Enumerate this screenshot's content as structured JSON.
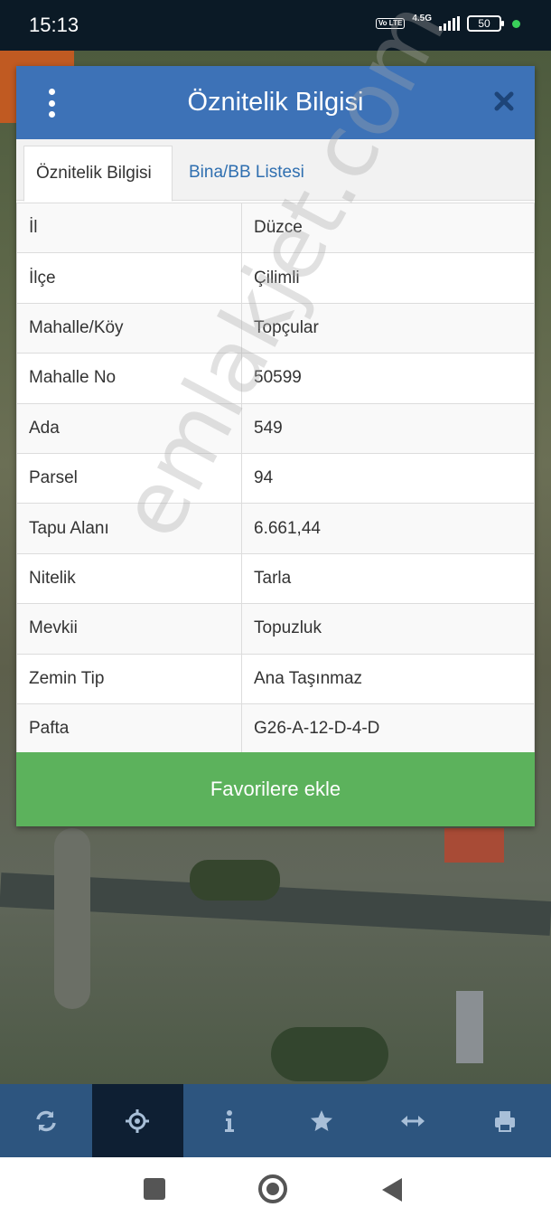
{
  "status_bar": {
    "time": "15:13",
    "network_badge": "Vo LTE",
    "network_type": "4.5G",
    "battery": "50"
  },
  "dialog": {
    "title": "Öznitelik Bilgisi",
    "tabs": [
      {
        "label": "Öznitelik Bilgisi",
        "active": true
      },
      {
        "label": "Bina/BB Listesi",
        "active": false
      }
    ],
    "rows": [
      {
        "key": "İl",
        "value": "Düzce"
      },
      {
        "key": "İlçe",
        "value": "Çilimli"
      },
      {
        "key": "Mahalle/Köy",
        "value": "Topçular"
      },
      {
        "key": "Mahalle No",
        "value": "50599"
      },
      {
        "key": "Ada",
        "value": "549"
      },
      {
        "key": "Parsel",
        "value": "94"
      },
      {
        "key": "Tapu Alanı",
        "value": "6.661,44"
      },
      {
        "key": "Nitelik",
        "value": "Tarla"
      },
      {
        "key": "Mevkii",
        "value": "Topuzluk"
      },
      {
        "key": "Zemin Tip",
        "value": "Ana Taşınmaz"
      },
      {
        "key": "Pafta",
        "value": "G26-A-12-D-4-D"
      }
    ],
    "favorite_button": "Favorilere ekle"
  },
  "watermark": "emlakjet.com",
  "toolbar": {
    "items": [
      {
        "icon": "refresh-icon",
        "active": false
      },
      {
        "icon": "crosshair-icon",
        "active": true
      },
      {
        "icon": "info-icon",
        "active": false
      },
      {
        "icon": "star-icon",
        "active": false
      },
      {
        "icon": "measure-icon",
        "active": false
      },
      {
        "icon": "print-icon",
        "active": false
      }
    ]
  },
  "colors": {
    "header": "#3d72b7",
    "tab_link": "#2f6fb0",
    "favorite": "#5cb25c",
    "toolbar": "#2d557f",
    "toolbar_active": "#0e1f33"
  }
}
